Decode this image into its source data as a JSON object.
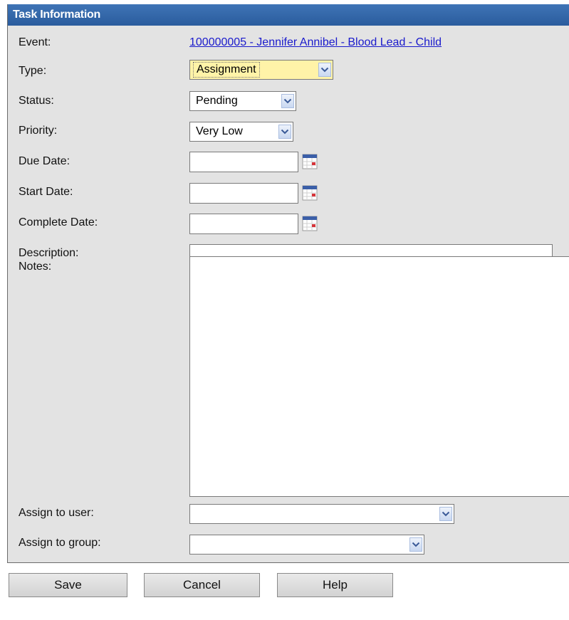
{
  "panel": {
    "title": "Task Information"
  },
  "fields": {
    "event_label": "Event:",
    "event_link": "100000005 - Jennifer Annibel - Blood Lead - Child",
    "type_label": "Type:",
    "type_value": "Assignment",
    "status_label": "Status:",
    "status_value": "Pending",
    "priority_label": "Priority:",
    "priority_value": "Very Low",
    "due_date_label": "Due Date:",
    "due_date_value": "",
    "start_date_label": "Start Date:",
    "start_date_value": "",
    "complete_date_label": "Complete Date:",
    "complete_date_value": "",
    "description_label": "Description:",
    "description_value": "",
    "notes_label": "Notes:",
    "notes_value": "",
    "assign_user_label": "Assign to user:",
    "assign_user_value": "",
    "assign_group_label": "Assign to group:",
    "assign_group_value": ""
  },
  "buttons": {
    "save": "Save",
    "cancel": "Cancel",
    "help": "Help"
  },
  "icons": {
    "dropdown": "chevron-down-icon",
    "calendar": "calendar-icon"
  },
  "colors": {
    "header_bg": "#2b5fa0",
    "panel_bg": "#e3e3e3",
    "link": "#1a1acc",
    "focus_highlight": "#fff3a8"
  }
}
